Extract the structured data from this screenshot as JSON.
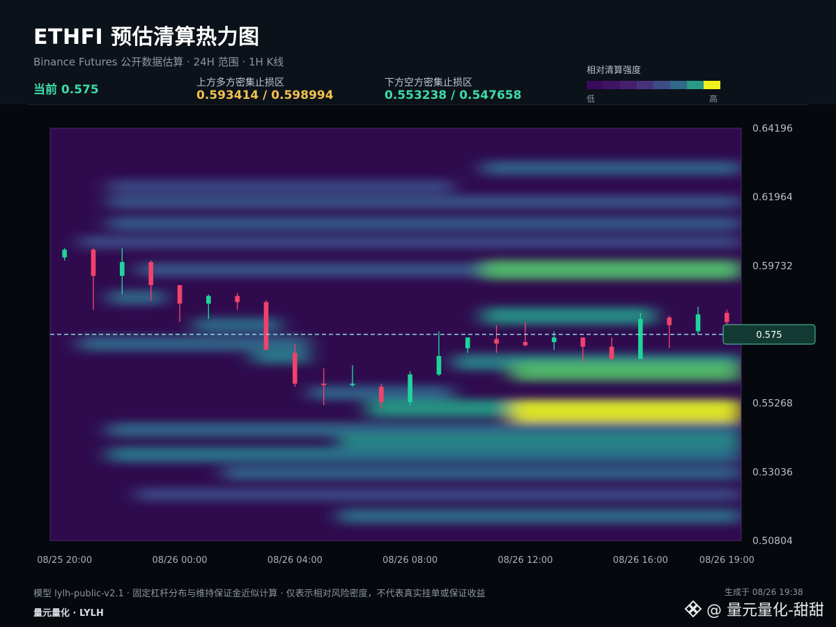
{
  "header": {
    "title": "ETHFI 预估清算热力图",
    "subtitle": "Binance Futures 公开数据估算 · 24H 范围 · 1H K线",
    "current": "当前 0.575",
    "upper_label": "上方多方密集止损区",
    "upper_value": "0.593414 / 0.598994",
    "lower_label": "下方空方密集止损区",
    "lower_value": "0.553238 / 0.547658"
  },
  "legend": {
    "title": "相对清算强度",
    "low": "低",
    "high": "高",
    "colors": [
      "#3b0a5a",
      "#3f1466",
      "#45206f",
      "#47337a",
      "#3e4c85",
      "#30698a",
      "#289a86",
      "#f0f01e"
    ]
  },
  "footer": {
    "note": "模型 lylh-public-v2.1 · 固定杠杆分布与维持保证金近似计算 · 仅表示相对风险密度，不代表真实挂单或保证收益",
    "brand": "量元量化 · LYLH",
    "generated": "生成于 08/26 19:38",
    "watermark": "@ 量元量化-甜甜"
  },
  "chart_data": {
    "type": "heatmap",
    "ylim": [
      0.50804,
      0.64196
    ],
    "y_ticks": [
      "0.64196",
      "0.61964",
      "0.59732",
      "0.57500",
      "0.55268",
      "0.53036",
      "0.50804"
    ],
    "y_tick_labels": [
      "0.64196",
      "0.61964",
      "0.59732",
      "",
      "0.55268",
      "0.53036",
      "0.50804"
    ],
    "x_tick_labels": [
      "08/25 20:00",
      "08/26 00:00",
      "08/26 04:00",
      "08/26 08:00",
      "08/26 12:00",
      "08/26 16:00",
      "08/26 19:00"
    ],
    "current_price": 0.575,
    "current_price_label": "0.575",
    "heat_bands": [
      {
        "price": 0.629,
        "from": 15,
        "to": 24,
        "intensity": 0.4
      },
      {
        "price": 0.623,
        "from": 2,
        "to": 14,
        "intensity": 0.28
      },
      {
        "price": 0.618,
        "from": 2,
        "to": 24,
        "intensity": 0.33
      },
      {
        "price": 0.611,
        "from": 2,
        "to": 24,
        "intensity": 0.36
      },
      {
        "price": 0.605,
        "from": 1,
        "to": 24,
        "intensity": 0.28
      },
      {
        "price": 0.596,
        "from": 3,
        "to": 24,
        "intensity": 0.34
      },
      {
        "price": 0.596,
        "from": 15,
        "to": 24,
        "intensity": 0.78
      },
      {
        "price": 0.587,
        "from": 2,
        "to": 4,
        "intensity": 0.42
      },
      {
        "price": 0.581,
        "from": 15,
        "to": 21,
        "intensity": 0.62
      },
      {
        "price": 0.578,
        "from": 5,
        "to": 8,
        "intensity": 0.45
      },
      {
        "price": 0.572,
        "from": 1,
        "to": 9,
        "intensity": 0.42
      },
      {
        "price": 0.568,
        "from": 7,
        "to": 9,
        "intensity": 0.52
      },
      {
        "price": 0.566,
        "from": 14,
        "to": 24,
        "intensity": 0.55
      },
      {
        "price": 0.563,
        "from": 16,
        "to": 24,
        "intensity": 0.78
      },
      {
        "price": 0.556,
        "from": 9,
        "to": 14,
        "intensity": 0.4
      },
      {
        "price": 0.551,
        "from": 11,
        "to": 24,
        "intensity": 0.65
      },
      {
        "price": 0.55,
        "from": 16,
        "to": 24,
        "intensity": 1.0
      },
      {
        "price": 0.544,
        "from": 2,
        "to": 24,
        "intensity": 0.42
      },
      {
        "price": 0.54,
        "from": 10,
        "to": 24,
        "intensity": 0.6
      },
      {
        "price": 0.536,
        "from": 2,
        "to": 24,
        "intensity": 0.5
      },
      {
        "price": 0.53,
        "from": 6,
        "to": 24,
        "intensity": 0.4
      },
      {
        "price": 0.523,
        "from": 3,
        "to": 24,
        "intensity": 0.28
      },
      {
        "price": 0.516,
        "from": 10,
        "to": 24,
        "intensity": 0.45
      }
    ],
    "candles": [
      {
        "o": 0.6,
        "h": 0.603,
        "l": 0.599,
        "c": 0.6025
      },
      {
        "o": 0.6025,
        "h": 0.603,
        "l": 0.583,
        "c": 0.594
      },
      {
        "o": 0.594,
        "h": 0.603,
        "l": 0.588,
        "c": 0.5985
      },
      {
        "o": 0.5985,
        "h": 0.599,
        "l": 0.586,
        "c": 0.591
      },
      {
        "o": 0.591,
        "h": 0.591,
        "l": 0.579,
        "c": 0.585
      },
      {
        "o": 0.585,
        "h": 0.588,
        "l": 0.58,
        "c": 0.5875
      },
      {
        "o": 0.5875,
        "h": 0.5885,
        "l": 0.583,
        "c": 0.5855
      },
      {
        "o": 0.5855,
        "h": 0.586,
        "l": 0.57,
        "c": 0.57
      },
      {
        "o": 0.569,
        "h": 0.572,
        "l": 0.558,
        "c": 0.559
      },
      {
        "o": 0.559,
        "h": 0.564,
        "l": 0.552,
        "c": 0.5585
      },
      {
        "o": 0.5585,
        "h": 0.565,
        "l": 0.558,
        "c": 0.559
      },
      {
        "o": 0.558,
        "h": 0.559,
        "l": 0.551,
        "c": 0.553
      },
      {
        "o": 0.553,
        "h": 0.563,
        "l": 0.552,
        "c": 0.562
      },
      {
        "o": 0.562,
        "h": 0.576,
        "l": 0.5615,
        "c": 0.568
      },
      {
        "o": 0.5705,
        "h": 0.574,
        "l": 0.569,
        "c": 0.574
      },
      {
        "o": 0.5735,
        "h": 0.578,
        "l": 0.569,
        "c": 0.572
      },
      {
        "o": 0.5725,
        "h": 0.579,
        "l": 0.571,
        "c": 0.5715
      },
      {
        "o": 0.5725,
        "h": 0.576,
        "l": 0.57,
        "c": 0.574
      },
      {
        "o": 0.574,
        "h": 0.574,
        "l": 0.566,
        "c": 0.571
      },
      {
        "o": 0.571,
        "h": 0.574,
        "l": 0.568,
        "c": 0.567
      },
      {
        "o": 0.567,
        "h": 0.582,
        "l": 0.567,
        "c": 0.58
      },
      {
        "o": 0.5805,
        "h": 0.581,
        "l": 0.5705,
        "c": 0.578
      },
      {
        "o": 0.576,
        "h": 0.584,
        "l": 0.575,
        "c": 0.5815
      },
      {
        "o": 0.582,
        "h": 0.583,
        "l": 0.576,
        "c": 0.579
      }
    ]
  }
}
